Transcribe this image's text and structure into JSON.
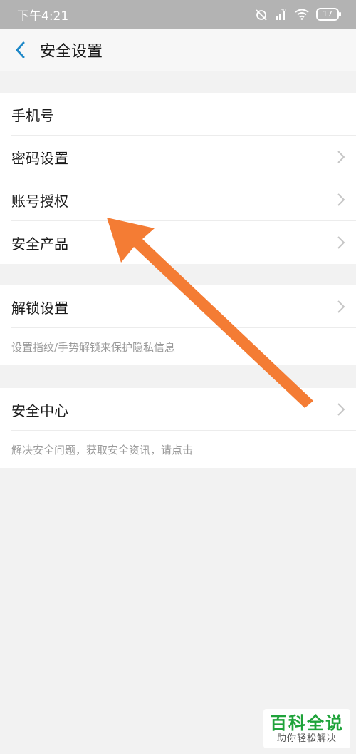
{
  "status_bar": {
    "time": "下午4:21",
    "battery": "17"
  },
  "header": {
    "title": "安全设置"
  },
  "groups": [
    {
      "items": [
        {
          "label": "手机号"
        },
        {
          "label": "密码设置"
        },
        {
          "label": "账号授权"
        },
        {
          "label": "安全产品"
        }
      ]
    },
    {
      "items": [
        {
          "label": "解锁设置"
        }
      ],
      "hint": "设置指纹/手势解锁来保护隐私信息"
    },
    {
      "items": [
        {
          "label": "安全中心"
        }
      ],
      "hint": "解决安全问题，获取安全资讯，请点击"
    }
  ],
  "watermark": {
    "main": "百科全说",
    "sub": "助你轻松解决"
  },
  "colors": {
    "arrow": "#f47c34",
    "accent": "#1e88c8",
    "watermark_green": "#1fa33a"
  }
}
